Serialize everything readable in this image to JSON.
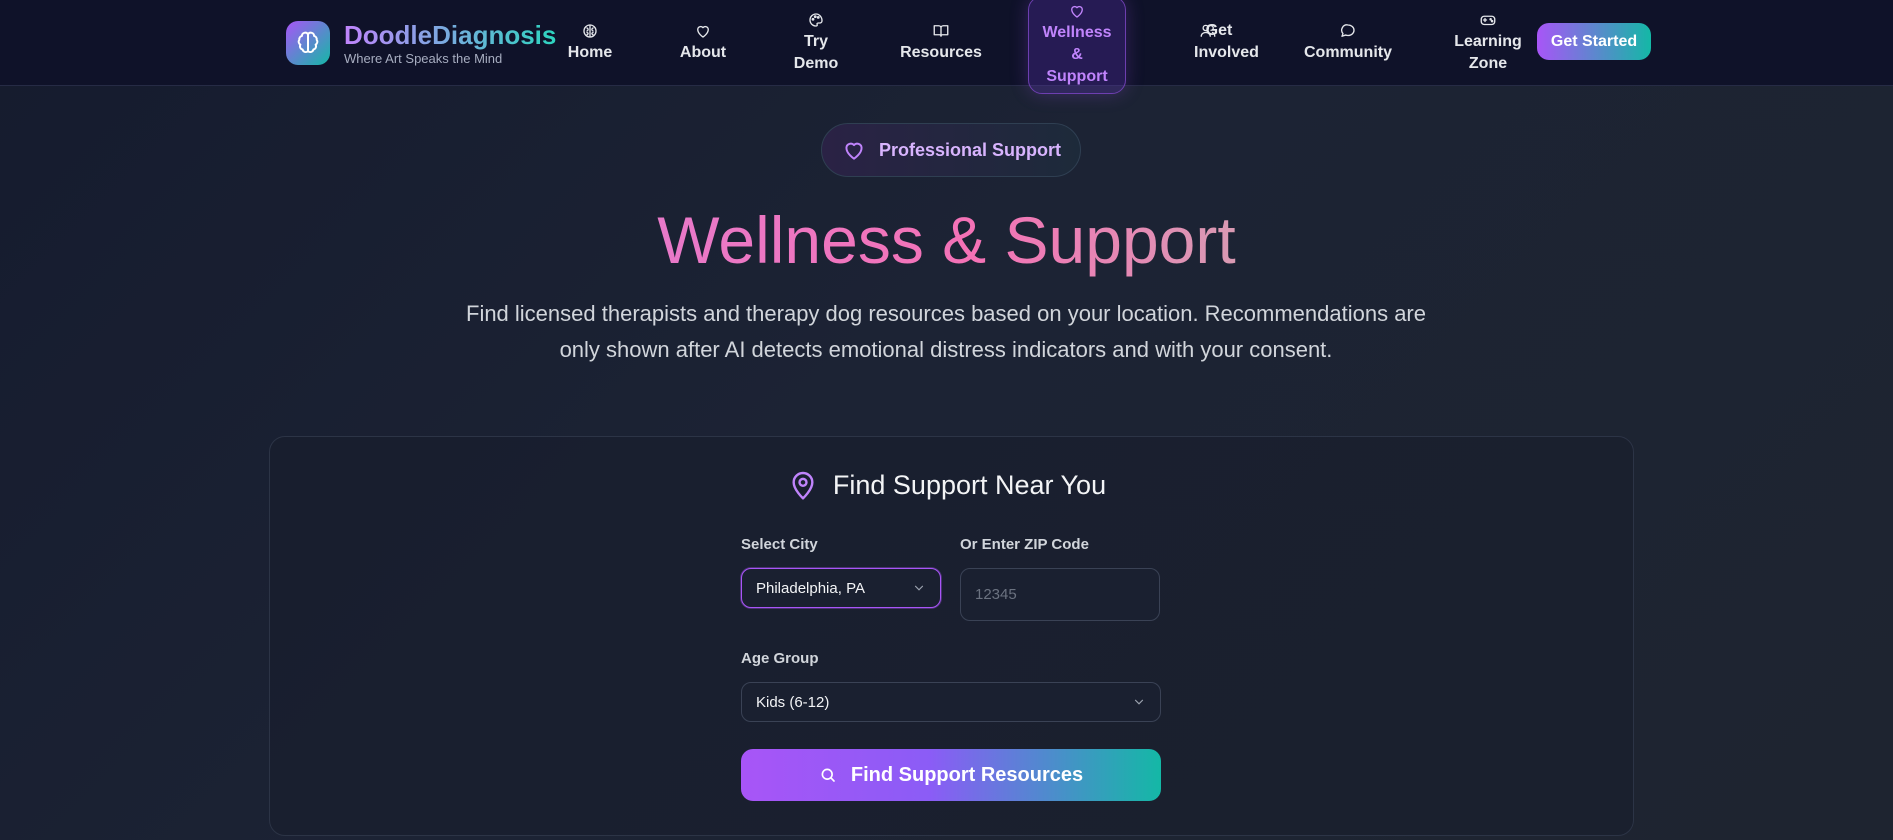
{
  "brand": {
    "name": "DoodleDiagnosis",
    "tagline": "Where Art Speaks the Mind"
  },
  "nav": {
    "items": [
      {
        "label": "Home",
        "icon": "brain-icon"
      },
      {
        "label": "About",
        "icon": "heart-icon"
      },
      {
        "label": "Try Demo",
        "icon": "palette-icon"
      },
      {
        "label": "Resources",
        "icon": "book-icon"
      },
      {
        "label": "Wellness & Support",
        "icon": "heart-icon",
        "active": true
      },
      {
        "label": "Get Involved",
        "icon": "users-icon"
      },
      {
        "label": "Community",
        "icon": "chat-icon"
      },
      {
        "label": "Learning Zone",
        "icon": "gamepad-icon"
      }
    ],
    "cta_label": "Get Started"
  },
  "hero": {
    "badge": "Professional Support",
    "title": "Wellness & Support",
    "subtitle": "Find licensed therapists and therapy dog resources based on your location. Recommendations are only shown after AI detects emotional distress indicators and with your consent."
  },
  "finder": {
    "heading": "Find Support Near You",
    "city_label": "Select City",
    "city_value": "Philadelphia, PA",
    "zip_label": "Or Enter ZIP Code",
    "zip_placeholder": "12345",
    "age_label": "Age Group",
    "age_value": "Kids (6-12)",
    "button_label": "Find Support Resources"
  },
  "colors": {
    "accent_purple": "#a855f7",
    "accent_teal": "#14b8a6",
    "title_pink": "#f472b6",
    "nav_bg": "#0f1229"
  }
}
